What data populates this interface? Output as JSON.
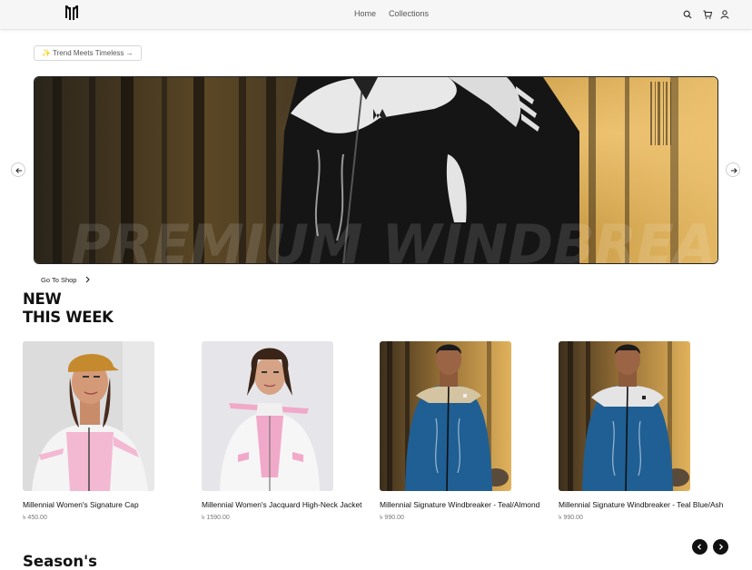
{
  "header": {
    "nav": {
      "home": "Home",
      "collections": "Collections"
    },
    "icons": [
      "search-icon",
      "cart-icon",
      "user-icon"
    ]
  },
  "hero": {
    "tag": "✨ Trend Meets Timeless →",
    "watermark": "PREMIUM WINDBREAKER",
    "go_to_shop": "Go To Shop"
  },
  "new_this_week": {
    "title_line1": "NEW",
    "title_line2": "THIS WEEK",
    "products": [
      {
        "name": "Millennial Women's Signature Cap",
        "price": "৳ 450.00"
      },
      {
        "name": "Millennial Women's Jacquard High-Neck Jacket",
        "price": "৳ 1590.00"
      },
      {
        "name": "Millennial Signature Windbreaker - Teal/Almond",
        "price": "৳ 990.00"
      },
      {
        "name": "Millennial Signature Windbreaker - Teal Blue/Ash",
        "price": "৳ 990.00"
      }
    ]
  },
  "next_section": {
    "title": "Season's"
  },
  "colors": {
    "accent": "#111111",
    "header_bg": "#f6f6f6"
  }
}
